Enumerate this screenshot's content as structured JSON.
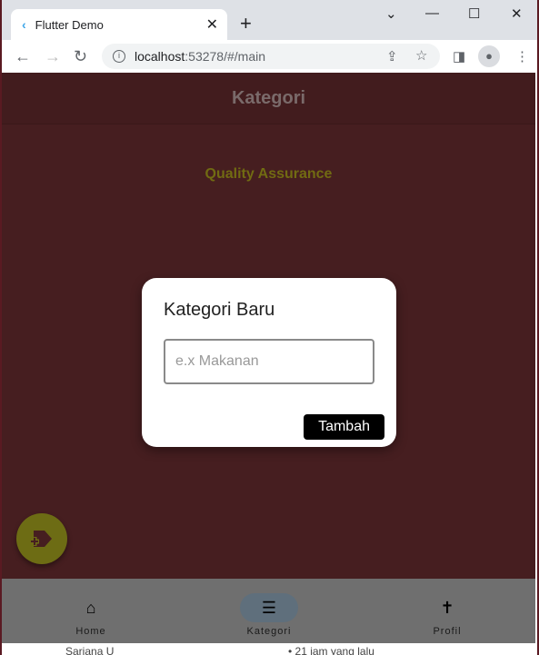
{
  "browser": {
    "tab_title": "Flutter Demo",
    "url_host": "localhost",
    "url_rest": ":53278/#/main"
  },
  "app": {
    "title": "Kategori",
    "category": "Quality Assurance"
  },
  "dialog": {
    "title": "Kategori Baru",
    "input_placeholder": "e.x Makanan",
    "input_value": "",
    "submit_label": "Tambah"
  },
  "bottom_nav": {
    "items": [
      {
        "label": "Home",
        "icon": "home-icon"
      },
      {
        "label": "Kategori",
        "icon": "list-icon",
        "active": true
      },
      {
        "label": "Profil",
        "icon": "accessibility-icon"
      }
    ]
  },
  "background_peek": {
    "name": "Sarjana U",
    "time": "• 21 jam yang lalu"
  }
}
